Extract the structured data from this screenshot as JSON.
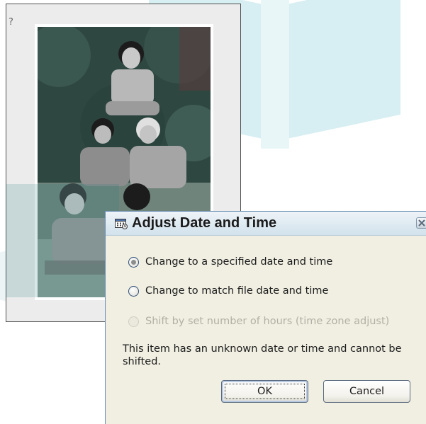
{
  "background_window": {
    "help_glyph": "?"
  },
  "dialog": {
    "title": "Adjust Date and Time",
    "title_icon": "calendar-clock-icon",
    "close_icon": "close-icon",
    "options": [
      {
        "label": "Change to a specified date and time",
        "checked": true,
        "enabled": true
      },
      {
        "label": "Change to match file date and time",
        "checked": false,
        "enabled": true
      },
      {
        "label": "Shift by set number of hours (time zone adjust)",
        "checked": false,
        "enabled": false
      }
    ],
    "message": "This item has an unknown date or time and cannot be shifted.",
    "ok_label": "OK",
    "cancel_label": "Cancel"
  },
  "colors": {
    "dialog_bg": "#f1efe2",
    "title_bar": "#dde9f1",
    "disabled_text": "#b2b0a4"
  }
}
